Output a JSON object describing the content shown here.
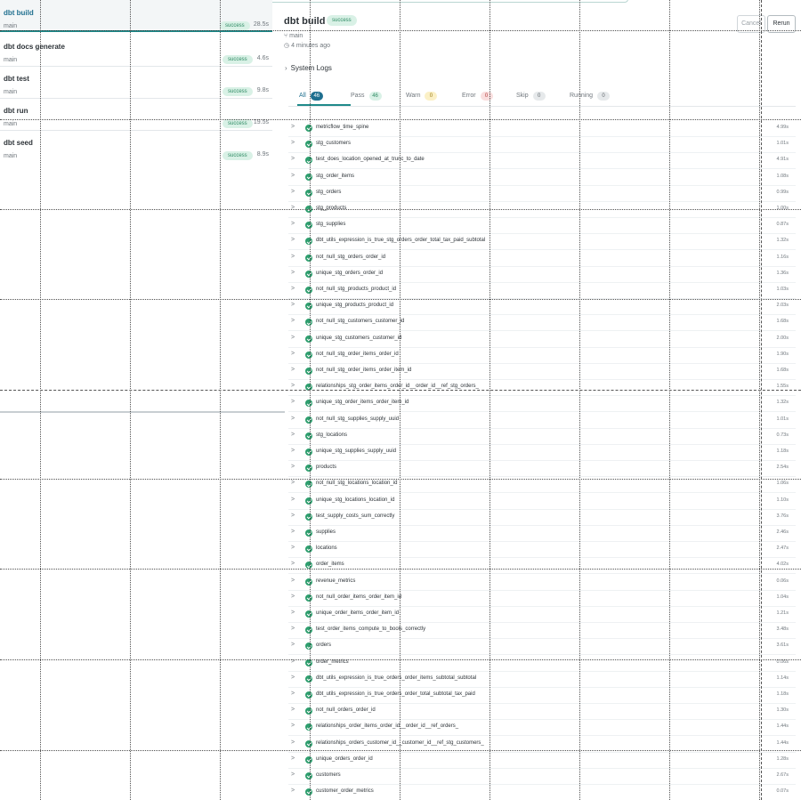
{
  "runs": [
    {
      "name": "dbt build",
      "branch": "main",
      "status": "success",
      "duration": "28.5s",
      "active": true
    },
    {
      "name": "dbt docs generate",
      "branch": "main",
      "status": "success",
      "duration": "4.6s"
    },
    {
      "name": "dbt test",
      "branch": "main",
      "status": "success",
      "duration": "9.8s"
    },
    {
      "name": "dbt run",
      "branch": "main",
      "status": "success",
      "duration": "19.5s"
    },
    {
      "name": "dbt seed",
      "branch": "main",
      "status": "success",
      "duration": "8.9s"
    }
  ],
  "detail": {
    "title": "dbt build",
    "status": "success",
    "branch": "main",
    "time_ago": "4 minutes ago",
    "cancel_label": "Cancel",
    "rerun_label": "Rerun",
    "system_logs_label": "System Logs"
  },
  "tabs": [
    {
      "label": "All",
      "count": "46",
      "bg": "#1f6f8f",
      "fg": "#ffffff"
    },
    {
      "label": "Pass",
      "count": "46",
      "bg": "#d9f1e6",
      "fg": "#2e8b64"
    },
    {
      "label": "Warn",
      "count": "0",
      "bg": "#fbf0c6",
      "fg": "#9a7a10"
    },
    {
      "label": "Error",
      "count": "0",
      "bg": "#f9dede",
      "fg": "#b23a3a"
    },
    {
      "label": "Skip",
      "count": "0",
      "bg": "#e6e9eb",
      "fg": "#5f666b"
    },
    {
      "label": "Running",
      "count": "0",
      "bg": "#e6e9eb",
      "fg": "#5f666b"
    }
  ],
  "nodes": [
    {
      "name": "metricflow_time_spine",
      "duration": "4.99s"
    },
    {
      "name": "stg_customers",
      "duration": "1.01s"
    },
    {
      "name": "test_does_location_opened_at_trunc_to_date",
      "duration": "4.91s"
    },
    {
      "name": "stg_order_items",
      "duration": "1.08s"
    },
    {
      "name": "stg_orders",
      "duration": "0.99s"
    },
    {
      "name": "stg_products",
      "duration": "1.00s"
    },
    {
      "name": "stg_supplies",
      "duration": "0.87s"
    },
    {
      "name": "dbt_utils_expression_is_true_stg_orders_order_total_tax_paid_subtotal",
      "duration": "1.32s"
    },
    {
      "name": "not_null_stg_orders_order_id",
      "duration": "1.16s"
    },
    {
      "name": "unique_stg_orders_order_id",
      "duration": "1.36s"
    },
    {
      "name": "not_null_stg_products_product_id",
      "duration": "1.03s"
    },
    {
      "name": "unique_stg_products_product_id",
      "duration": "2.03s"
    },
    {
      "name": "not_null_stg_customers_customer_id",
      "duration": "1.68s"
    },
    {
      "name": "unique_stg_customers_customer_id",
      "duration": "2.00s"
    },
    {
      "name": "not_null_stg_order_items_order_id",
      "duration": "1.90s"
    },
    {
      "name": "not_null_stg_order_items_order_item_id",
      "duration": "1.68s"
    },
    {
      "name": "relationships_stg_order_items_order_id__order_id__ref_stg_orders_",
      "duration": "1.55s"
    },
    {
      "name": "unique_stg_order_items_order_item_id",
      "duration": "1.32s"
    },
    {
      "name": "not_null_stg_supplies_supply_uuid",
      "duration": "1.01s"
    },
    {
      "name": "stg_locations",
      "duration": "0.73s"
    },
    {
      "name": "unique_stg_supplies_supply_uuid",
      "duration": "1.18s"
    },
    {
      "name": "products",
      "duration": "2.54s"
    },
    {
      "name": "not_null_stg_locations_location_id",
      "duration": "1.06s"
    },
    {
      "name": "unique_stg_locations_location_id",
      "duration": "1.10s"
    },
    {
      "name": "test_supply_costs_sum_correctly",
      "duration": "3.76s"
    },
    {
      "name": "supplies",
      "duration": "2.46s"
    },
    {
      "name": "locations",
      "duration": "2.47s"
    },
    {
      "name": "order_items",
      "duration": "4.02s"
    },
    {
      "name": "revenue_metrics",
      "duration": "0.06s"
    },
    {
      "name": "not_null_order_items_order_item_id",
      "duration": "1.04s"
    },
    {
      "name": "unique_order_items_order_item_id",
      "duration": "1.21s"
    },
    {
      "name": "test_order_items_compute_to_bools_correctly",
      "duration": "3.48s"
    },
    {
      "name": "orders",
      "duration": "3.61s"
    },
    {
      "name": "order_metrics",
      "duration": "0.06s"
    },
    {
      "name": "dbt_utils_expression_is_true_orders_order_items_subtotal_subtotal",
      "duration": "1.14s"
    },
    {
      "name": "dbt_utils_expression_is_true_orders_order_total_subtotal_tax_paid",
      "duration": "1.18s"
    },
    {
      "name": "not_null_orders_order_id",
      "duration": "1.30s"
    },
    {
      "name": "relationships_order_items_order_id__order_id__ref_orders_",
      "duration": "1.44s"
    },
    {
      "name": "relationships_orders_customer_id__customer_id__ref_stg_customers_",
      "duration": "1.44s"
    },
    {
      "name": "unique_orders_order_id",
      "duration": "1.28s"
    },
    {
      "name": "customers",
      "duration": "2.67s"
    },
    {
      "name": "customer_order_metrics",
      "duration": "0.07s"
    }
  ]
}
